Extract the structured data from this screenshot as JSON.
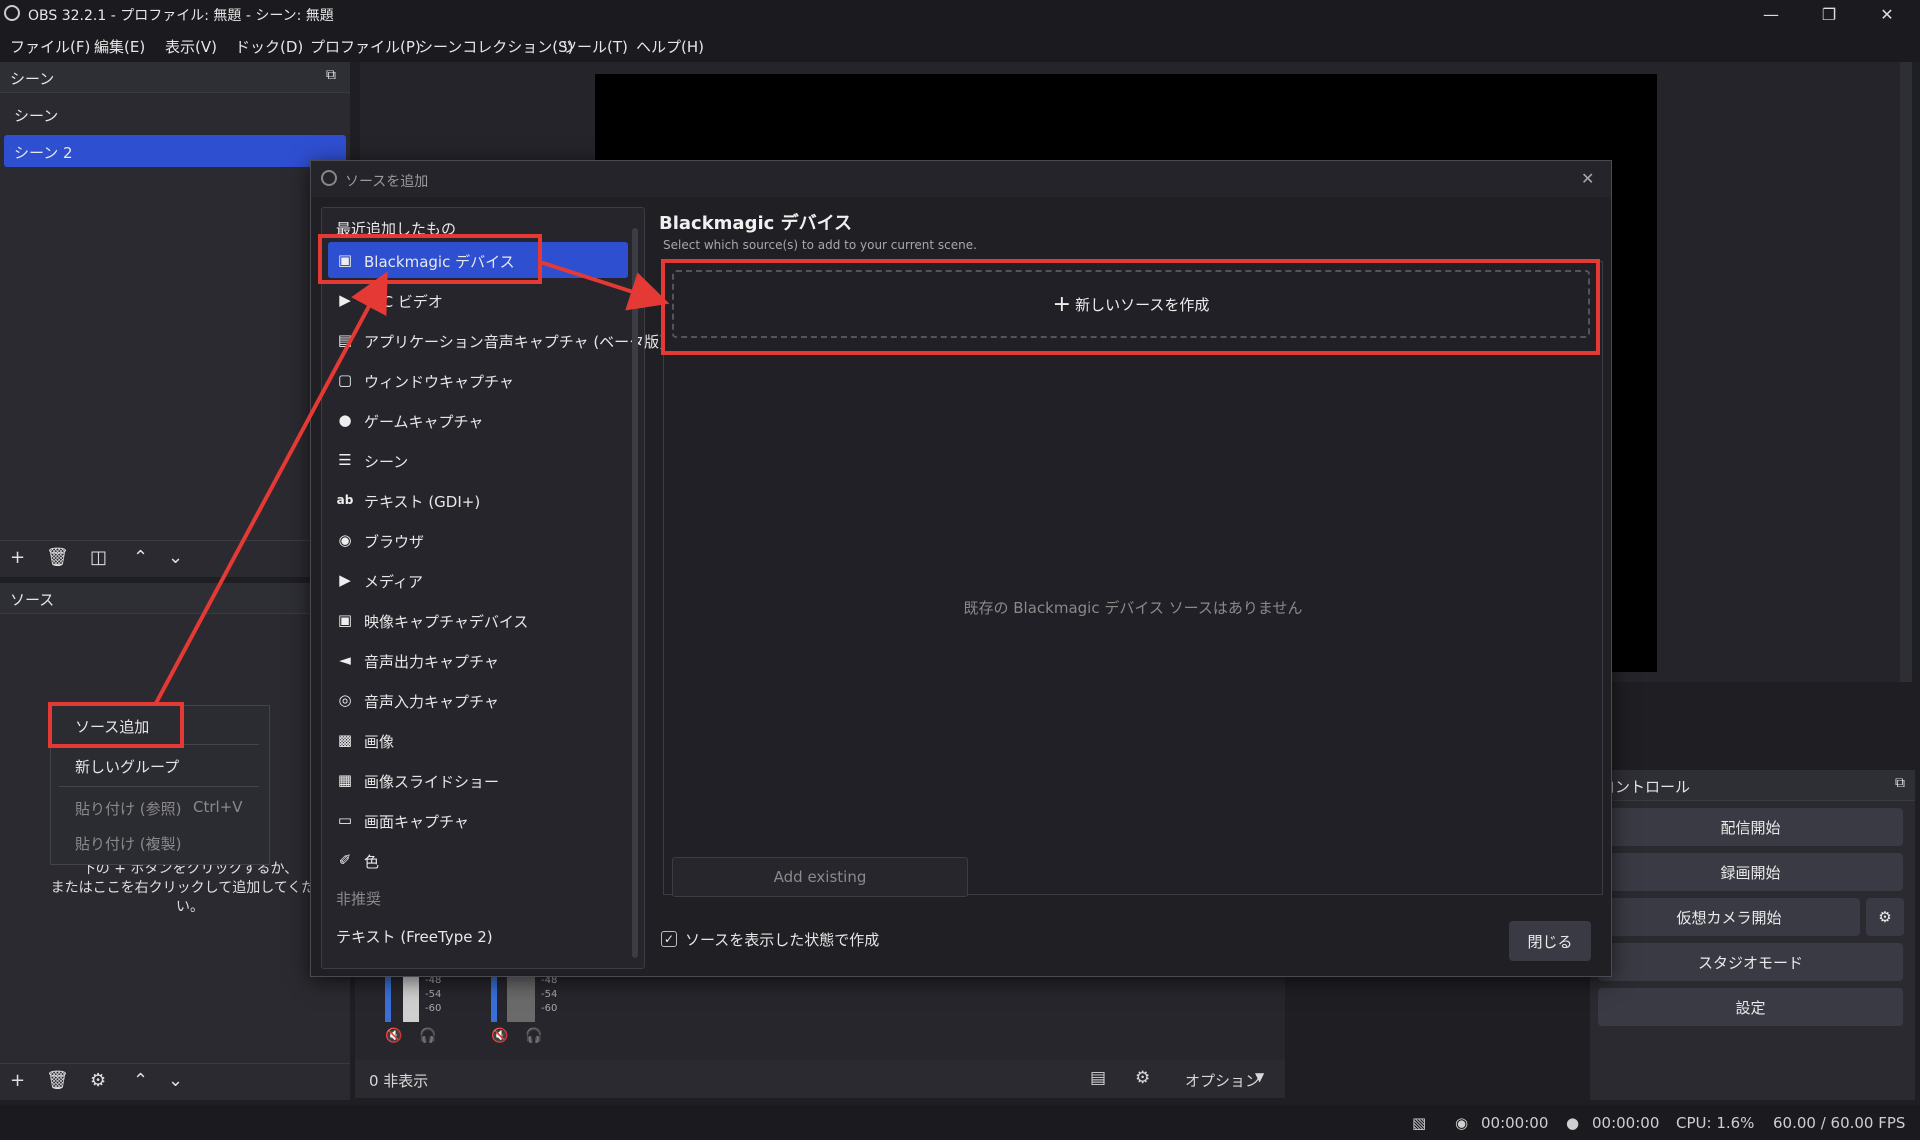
{
  "window": {
    "title": "OBS 32.2.1 - プロファイル: 無題 - シーン: 無題"
  },
  "menu": [
    "ファイル(F)",
    "編集(E)",
    "表示(V)",
    "ドック(D)",
    "プロファイル(P)",
    "シーンコレクション(S)",
    "ツール(T)",
    "ヘルプ(H)"
  ],
  "scenes": {
    "title": "シーン",
    "items": [
      "シーン",
      "シーン 2"
    ]
  },
  "sources": {
    "title": "ソース",
    "hint_line1": "下の + ボタンをクリックするか、",
    "hint_line2": "またはここを右クリックして追加してください。"
  },
  "context_menu": {
    "items": [
      "ソース追加",
      "新しいグループ",
      "貼り付け (参照)",
      "貼り付け (複製)"
    ],
    "shortcut": "Ctrl+V"
  },
  "dialog": {
    "title": "ソースを追加",
    "recent_header": "最近追加したもの",
    "items": [
      {
        "label": "Blackmagic デバイス",
        "icon": "camera-icon"
      },
      {
        "label": "VLC ビデオ",
        "icon": "play-icon"
      },
      {
        "label": "アプリケーション音声キャプチャ (ベータ版)",
        "icon": "app-audio-icon"
      },
      {
        "label": "ウィンドウキャプチャ",
        "icon": "window-icon"
      },
      {
        "label": "ゲームキャプチャ",
        "icon": "gamepad-icon"
      },
      {
        "label": "シーン",
        "icon": "list-icon"
      },
      {
        "label": "テキスト (GDI+)",
        "icon": "text-icon"
      },
      {
        "label": "ブラウザ",
        "icon": "globe-icon"
      },
      {
        "label": "メディア",
        "icon": "play-icon"
      },
      {
        "label": "映像キャプチャデバイス",
        "icon": "camera-icon"
      },
      {
        "label": "音声出力キャプチャ",
        "icon": "speaker-icon"
      },
      {
        "label": "音声入力キャプチャ",
        "icon": "mic-icon"
      },
      {
        "label": "画像",
        "icon": "image-icon"
      },
      {
        "label": "画像スライドショー",
        "icon": "slideshow-icon"
      },
      {
        "label": "画面キャプチャ",
        "icon": "monitor-icon"
      },
      {
        "label": "色",
        "icon": "brush-icon"
      }
    ],
    "deprecated_header": "非推奨",
    "deprecated_items": [
      "テキスト (FreeType 2)"
    ],
    "panel_title": "Blackmagic デバイス",
    "panel_subtitle": "Select which source(s) to add to your current scene.",
    "create_new": "新しいソースを作成",
    "empty_text": "既存の Blackmagic デバイス ソースはありません",
    "add_existing": "Add existing",
    "checkbox_label": "ソースを表示した状態で作成",
    "close_button": "閉じる"
  },
  "mixer": {
    "ticks": [
      "-48",
      "-54",
      "-60"
    ]
  },
  "transitions": {
    "hidden_count": "0 非表示",
    "options": "オプション"
  },
  "controls": {
    "title": "コントロール",
    "buttons": [
      "配信開始",
      "録画開始",
      "仮想カメラ開始",
      "スタジオモード",
      "設定"
    ]
  },
  "status": {
    "stream_time": "00:00:00",
    "rec_time": "00:00:00",
    "cpu": "CPU: 1.6%",
    "fps": "60.00 / 60.00 FPS"
  },
  "colors": {
    "accent": "#2f4fd1",
    "highlight": "#e53935"
  }
}
